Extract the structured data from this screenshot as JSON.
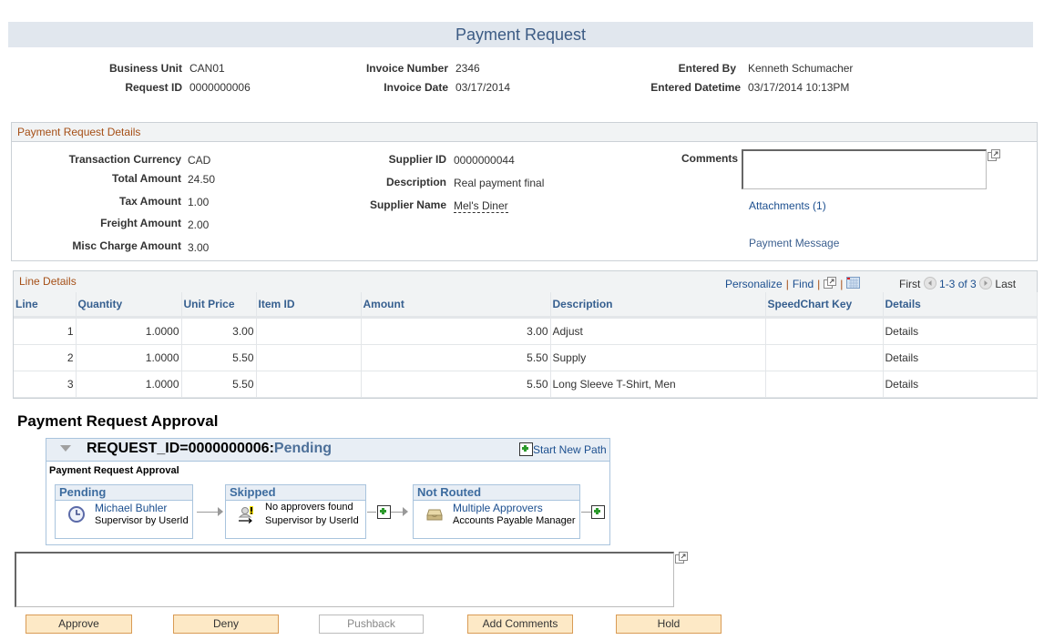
{
  "page": {
    "title": "Payment Request"
  },
  "header_fields": {
    "business_unit": {
      "label": "Business Unit",
      "value": "CAN01"
    },
    "request_id": {
      "label": "Request ID",
      "value": "0000000006"
    },
    "invoice_number": {
      "label": "Invoice Number",
      "value": "2346"
    },
    "invoice_date": {
      "label": "Invoice Date",
      "value": "03/17/2014"
    },
    "entered_by": {
      "label": "Entered By",
      "value": "Kenneth Schumacher"
    },
    "entered_datetime": {
      "label": "Entered Datetime",
      "value": "03/17/2014 10:13PM"
    }
  },
  "details": {
    "section_title": "Payment Request Details",
    "transaction_currency": {
      "label": "Transaction Currency",
      "value": "CAD"
    },
    "total_amount": {
      "label": "Total Amount",
      "value": "24.50"
    },
    "tax_amount": {
      "label": "Tax Amount",
      "value": "1.00"
    },
    "freight_amount": {
      "label": "Freight Amount",
      "value": "2.00"
    },
    "misc_charge_amount": {
      "label": "Misc Charge Amount",
      "value": "3.00"
    },
    "supplier_id": {
      "label": "Supplier ID",
      "value": "0000000044"
    },
    "description": {
      "label": "Description",
      "value": "Real payment final"
    },
    "supplier_name": {
      "label": "Supplier Name",
      "value": "Mel's Diner"
    },
    "comments": {
      "label": "Comments",
      "value": ""
    },
    "attachments_link": "Attachments (1)",
    "payment_message_link": "Payment Message"
  },
  "line_details": {
    "section_title": "Line Details",
    "toolbar": {
      "personalize": "Personalize",
      "find": "Find",
      "first": "First",
      "range": "1-3 of 3",
      "last": "Last"
    },
    "columns": [
      "Line",
      "Quantity",
      "Unit Price",
      "Item ID",
      "Amount",
      "Description",
      "SpeedChart Key",
      "Details"
    ],
    "rows": [
      {
        "line": "1",
        "quantity": "1.0000",
        "unit_price": "3.00",
        "item_id": "",
        "amount": "3.00",
        "description": "Adjust",
        "speedchart_key": "",
        "details": "Details"
      },
      {
        "line": "2",
        "quantity": "1.0000",
        "unit_price": "5.50",
        "item_id": "",
        "amount": "5.50",
        "description": "Supply",
        "speedchart_key": "",
        "details": "Details"
      },
      {
        "line": "3",
        "quantity": "1.0000",
        "unit_price": "5.50",
        "item_id": "",
        "amount": "5.50",
        "description": "Long Sleeve T-Shirt, Men",
        "speedchart_key": "",
        "details": "Details"
      }
    ]
  },
  "approval": {
    "heading": "Payment Request Approval",
    "request_key": "REQUEST_ID=0000000006:",
    "request_status": "Pending",
    "start_new_path": "Start New Path",
    "stage_name": "Payment Request Approval",
    "steps": [
      {
        "status": "Pending",
        "name": "Michael Buhler",
        "role": "Supervisor by UserId",
        "icon": "clock-icon"
      },
      {
        "status": "Skipped",
        "name": "No approvers found",
        "role": "Supervisor by UserId",
        "icon": "user-warning-icon"
      },
      {
        "status": "Not Routed",
        "name": "Multiple Approvers",
        "role": "Accounts Payable Manager",
        "icon": "inbox-tray-icon"
      }
    ],
    "comment_value": ""
  },
  "actions": {
    "approve": "Approve",
    "deny": "Deny",
    "pushback": "Pushback",
    "add_comments": "Add Comments",
    "hold": "Hold"
  },
  "colors": {
    "title_bar": "#e1e7ee",
    "link": "#1c4f8f",
    "section_header_text": "#a54f16",
    "action_button": "#fde9c6",
    "approval_border": "#a9c4dd"
  }
}
